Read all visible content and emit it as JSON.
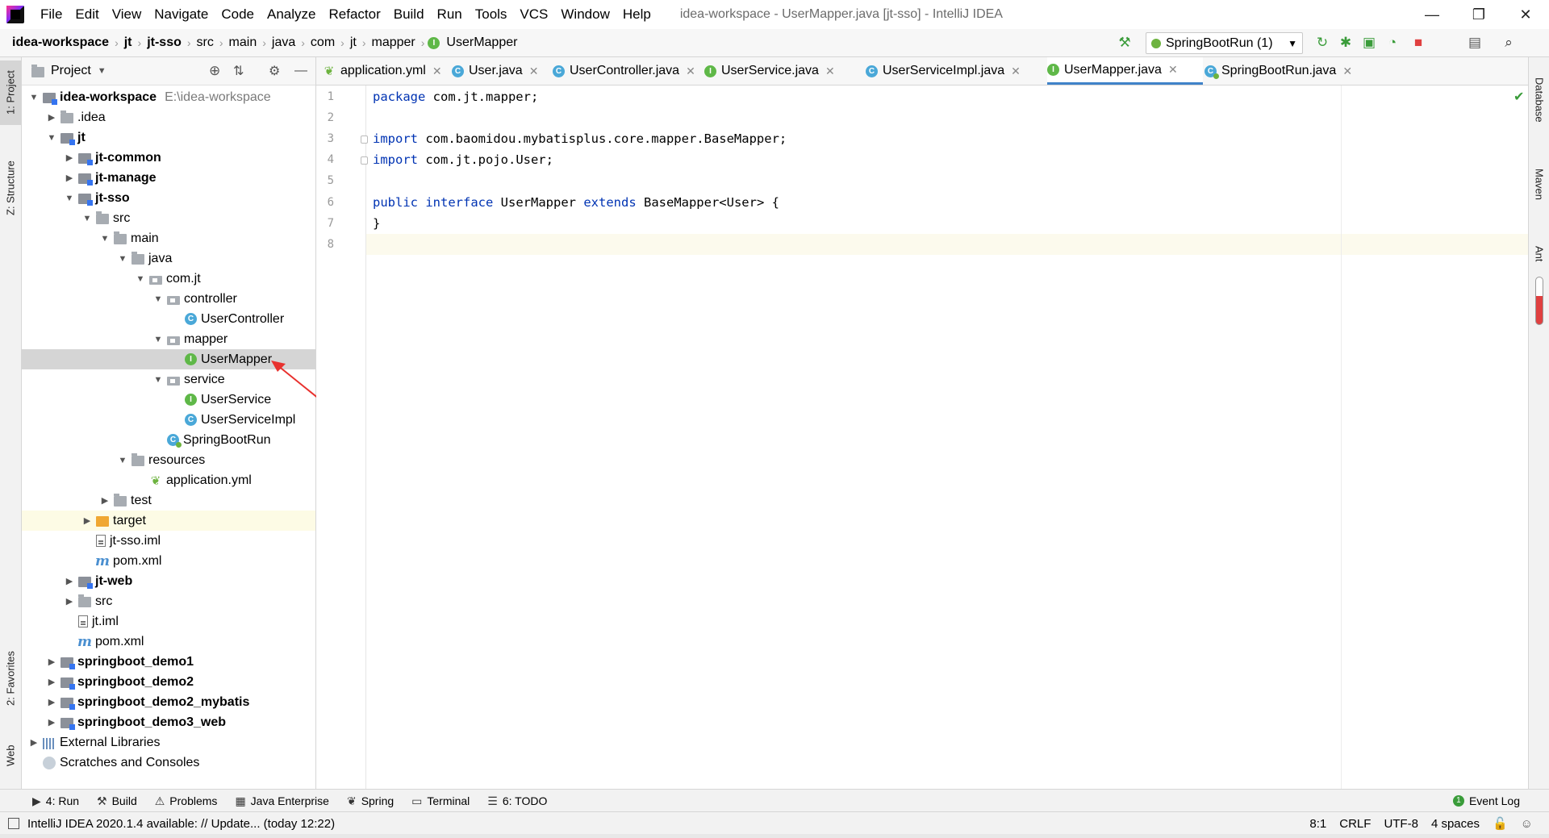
{
  "window": {
    "title": "idea-workspace - UserMapper.java [jt-sso] - IntelliJ IDEA",
    "controls": {
      "minimize": "—",
      "restore": "❐",
      "close": "✕"
    }
  },
  "menu": [
    "File",
    "Edit",
    "View",
    "Navigate",
    "Code",
    "Analyze",
    "Refactor",
    "Build",
    "Run",
    "Tools",
    "VCS",
    "Window",
    "Help"
  ],
  "breadcrumb": [
    "idea-workspace",
    "jt",
    "jt-sso",
    "src",
    "main",
    "java",
    "com",
    "jt",
    "mapper",
    "UserMapper"
  ],
  "toolbar": {
    "run_config": "SpringBootRun (1)"
  },
  "left_stripe": {
    "project": "1: Project",
    "structure": "Z: Structure",
    "favorites": "2: Favorites",
    "web": "Web"
  },
  "right_stripe": {
    "database": "Database",
    "maven": "Maven",
    "ant": "Ant"
  },
  "project_panel": {
    "title": "Project",
    "tree": [
      {
        "label": "idea-workspace",
        "path": "E:\\idea-workspace",
        "icon": "module-icon",
        "bold": true,
        "arrow": "down"
      },
      {
        "label": ".idea",
        "icon": "folder-icon",
        "arrow": "right"
      },
      {
        "label": "jt",
        "icon": "module-icon",
        "bold": true,
        "arrow": "down"
      },
      {
        "label": "jt-common",
        "icon": "module-icon",
        "bold": true,
        "arrow": "right"
      },
      {
        "label": "jt-manage",
        "icon": "module-icon",
        "bold": true,
        "arrow": "right"
      },
      {
        "label": "jt-sso",
        "icon": "module-icon",
        "bold": true,
        "arrow": "down"
      },
      {
        "label": "src",
        "icon": "folder-icon",
        "arrow": "down"
      },
      {
        "label": "main",
        "icon": "folder-icon",
        "arrow": "down"
      },
      {
        "label": "java",
        "icon": "folder-icon",
        "arrow": "down"
      },
      {
        "label": "com.jt",
        "icon": "package-icon",
        "arrow": "down"
      },
      {
        "label": "controller",
        "icon": "package-icon",
        "arrow": "down"
      },
      {
        "label": "UserController",
        "icon": "class-icon",
        "arrow": ""
      },
      {
        "label": "mapper",
        "icon": "package-icon",
        "arrow": "down"
      },
      {
        "label": "UserMapper",
        "icon": "interface-icon",
        "arrow": ""
      },
      {
        "label": "service",
        "icon": "package-icon",
        "arrow": "down"
      },
      {
        "label": "UserService",
        "icon": "interface-icon",
        "arrow": ""
      },
      {
        "label": "UserServiceImpl",
        "icon": "class-icon",
        "arrow": ""
      },
      {
        "label": "SpringBootRun",
        "icon": "spring-boot-class-icon",
        "arrow": ""
      },
      {
        "label": "resources",
        "icon": "folder-icon",
        "arrow": "down"
      },
      {
        "label": "application.yml",
        "icon": "yml-icon",
        "arrow": ""
      },
      {
        "label": "test",
        "icon": "folder-icon",
        "arrow": "right"
      },
      {
        "label": "target",
        "icon": "target-folder-icon",
        "arrow": "right"
      },
      {
        "label": "jt-sso.iml",
        "icon": "file-icon",
        "arrow": ""
      },
      {
        "label": "pom.xml",
        "icon": "maven-icon",
        "arrow": ""
      },
      {
        "label": "jt-web",
        "icon": "module-icon",
        "bold": true,
        "arrow": "right"
      },
      {
        "label": "src",
        "icon": "folder-icon",
        "arrow": "right"
      },
      {
        "label": "jt.iml",
        "icon": "file-icon",
        "arrow": ""
      },
      {
        "label": "pom.xml",
        "icon": "maven-icon",
        "arrow": ""
      },
      {
        "label": "springboot_demo1",
        "icon": "module-icon",
        "bold": true,
        "arrow": "right"
      },
      {
        "label": "springboot_demo2",
        "icon": "module-icon",
        "bold": true,
        "arrow": "right"
      },
      {
        "label": "springboot_demo2_mybatis",
        "icon": "module-icon",
        "bold": true,
        "arrow": "right"
      },
      {
        "label": "springboot_demo3_web",
        "icon": "module-icon",
        "bold": true,
        "arrow": "right"
      },
      {
        "label": "External Libraries",
        "icon": "libraries-icon",
        "arrow": "right"
      },
      {
        "label": "Scratches and Consoles",
        "icon": "scratches-icon",
        "arrow": ""
      }
    ]
  },
  "editor_tabs": [
    {
      "label": "application.yml",
      "icon": "yml-icon"
    },
    {
      "label": "User.java",
      "icon": "class-icon"
    },
    {
      "label": "UserController.java",
      "icon": "class-icon"
    },
    {
      "label": "UserService.java",
      "icon": "interface-icon"
    },
    {
      "label": "UserServiceImpl.java",
      "icon": "class-icon"
    },
    {
      "label": "UserMapper.java",
      "icon": "interface-icon",
      "active": true
    },
    {
      "label": "SpringBootRun.java",
      "icon": "spring-boot-class-icon"
    }
  ],
  "editor": {
    "lines": [
      [
        {
          "t": "package",
          "kw": true
        },
        {
          "t": " com.jt.mapper;"
        }
      ],
      [],
      [
        {
          "t": "import",
          "kw": true
        },
        {
          "t": " com.baomidou.mybatisplus.core.mapper.BaseMapper;"
        }
      ],
      [
        {
          "t": "import",
          "kw": true
        },
        {
          "t": " com.jt.pojo.User;"
        }
      ],
      [],
      [
        {
          "t": "public",
          "kw": true
        },
        {
          "t": " "
        },
        {
          "t": "interface",
          "kw": true
        },
        {
          "t": " UserMapper "
        },
        {
          "t": "extends",
          "kw": true
        },
        {
          "t": " BaseMapper<User> {"
        }
      ],
      [
        {
          "t": "}"
        }
      ],
      []
    ]
  },
  "bottom_tools": [
    {
      "label": "4: Run",
      "icon": "run-icon"
    },
    {
      "label": "Build",
      "icon": "hammer-icon"
    },
    {
      "label": "Problems",
      "icon": "warning-icon"
    },
    {
      "label": "Java Enterprise",
      "icon": "java-enterprise-icon"
    },
    {
      "label": "Spring",
      "icon": "spring-icon"
    },
    {
      "label": "Terminal",
      "icon": "terminal-icon"
    },
    {
      "label": "6: TODO",
      "icon": "todo-icon"
    }
  ],
  "event_log": "Event Log",
  "status": {
    "message": "IntelliJ IDEA 2020.1.4 available: // Update... (today 12:22)",
    "position": "8:1",
    "line_sep": "CRLF",
    "encoding": "UTF-8",
    "indent": "4 spaces"
  },
  "colors": {
    "keyword": "#0033b3",
    "selection": "#d5d5d5",
    "caret_line": "#fcfaed",
    "accent": "#4083c9"
  }
}
